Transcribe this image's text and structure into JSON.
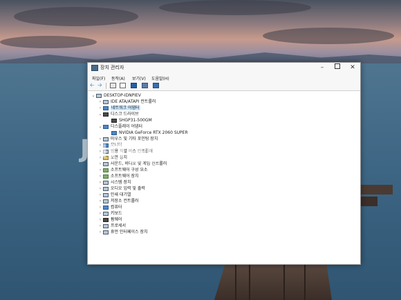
{
  "window": {
    "title": "장치 관리자",
    "menu": [
      "파일(F)",
      "동작(A)",
      "보기(V)",
      "도움말(H)"
    ]
  },
  "tree": {
    "root": "DESKTOP-IDNPIEV",
    "items": [
      {
        "label": "IDE ATA/ATAPI 컨트롤러",
        "expander": "›",
        "icon": "ide-controller-icon"
      },
      {
        "label": "네트워크 어댑터",
        "expander": "›",
        "icon": "network-adapter-icon"
      },
      {
        "label": "디스크 드라이브",
        "expander": "⌄",
        "icon": "disk-drive-icon"
      },
      {
        "label": "SHGP31-500GM",
        "expander": "",
        "icon": "disk-icon"
      },
      {
        "label": "디스플레이 어댑터",
        "expander": "⌄",
        "icon": "display-adapter-icon"
      },
      {
        "label": "NVIDIA GeForce RTX 2060 SUPER",
        "expander": "",
        "icon": "gpu-icon"
      },
      {
        "label": "마우스 및 기타 포인팅 장치",
        "expander": "›",
        "icon": "mouse-icon"
      },
      {
        "label": "모니터",
        "expander": "›",
        "icon": "monitor-icon"
      },
      {
        "label": "범용 직렬 버스 컨트롤러",
        "expander": "›",
        "icon": "usb-icon"
      },
      {
        "label": "보안 장치",
        "expander": "›",
        "icon": "security-device-icon"
      },
      {
        "label": "사운드, 비디오 및 게임 컨트롤러",
        "expander": "›",
        "icon": "sound-icon"
      },
      {
        "label": "소프트웨어 구성 요소",
        "expander": "›",
        "icon": "software-component-icon"
      },
      {
        "label": "소프트웨어 장치",
        "expander": "›",
        "icon": "software-device-icon"
      },
      {
        "label": "시스템 장치",
        "expander": "›",
        "icon": "system-device-icon"
      },
      {
        "label": "오디오 입력 및 출력",
        "expander": "›",
        "icon": "audio-icon"
      },
      {
        "label": "인쇄 대기열",
        "expander": "›",
        "icon": "print-queue-icon"
      },
      {
        "label": "저장소 컨트롤러",
        "expander": "›",
        "icon": "storage-controller-icon"
      },
      {
        "label": "컴퓨터",
        "expander": "›",
        "icon": "computer-icon"
      },
      {
        "label": "키보드",
        "expander": "›",
        "icon": "keyboard-icon"
      },
      {
        "label": "펌웨어",
        "expander": "›",
        "icon": "firmware-icon"
      },
      {
        "label": "프로세서",
        "expander": "›",
        "icon": "processor-icon"
      },
      {
        "label": "휴먼 인터페이스 장치",
        "expander": "›",
        "icon": "hid-icon"
      }
    ]
  },
  "watermark": "Junggonara"
}
